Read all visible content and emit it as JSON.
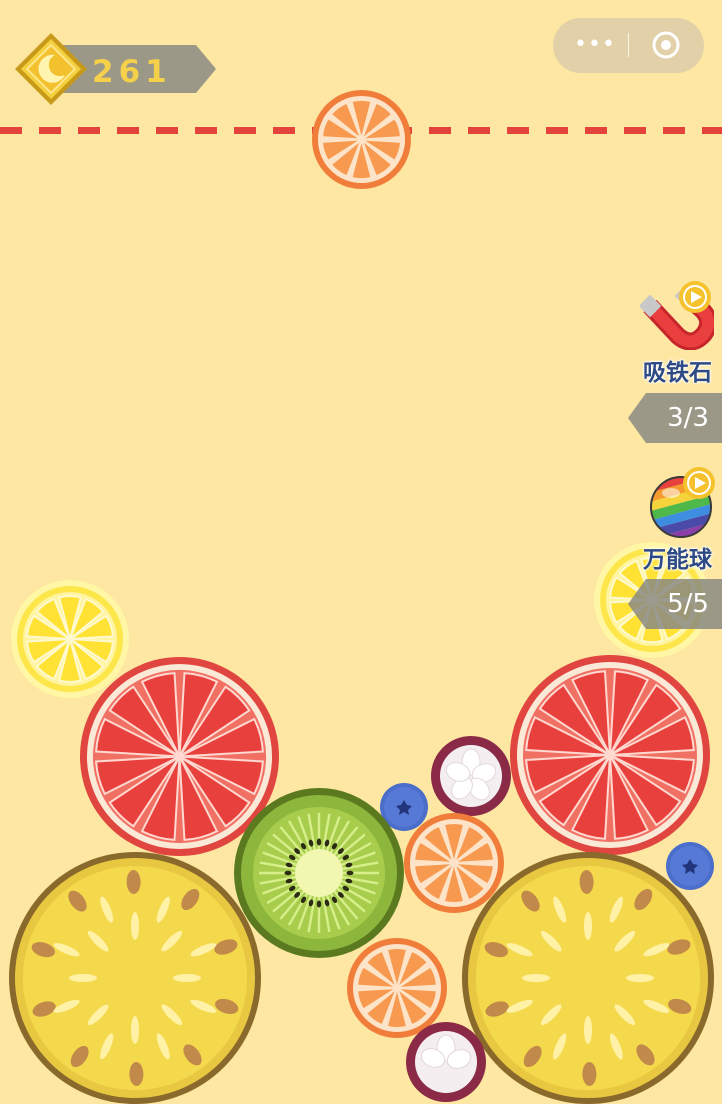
{
  "hud": {
    "score": "261",
    "score_icon": "moon-coin-icon",
    "menu_capsule": {
      "more_icon": "more-dots-icon",
      "close_icon": "target-circle-icon",
      "more_glyph": "•••"
    }
  },
  "powerups": [
    {
      "name": "吸铁石",
      "count": "3/3",
      "icon": "magnet-icon",
      "badge": "play-video-icon"
    },
    {
      "name": "万能球",
      "count": "5/5",
      "icon": "rainbow-ball-icon",
      "badge": "play-video-icon"
    }
  ],
  "playfield": {
    "limit_line_color": "#e3433b",
    "background_color": "#fde7a2",
    "next_fruit": "orange",
    "fruits": [
      {
        "kind": "orange",
        "role": "dropping"
      },
      {
        "kind": "lemon"
      },
      {
        "kind": "lemon"
      },
      {
        "kind": "grapefruit"
      },
      {
        "kind": "grapefruit"
      },
      {
        "kind": "kiwi"
      },
      {
        "kind": "mangosteen"
      },
      {
        "kind": "mangosteen"
      },
      {
        "kind": "blueberry"
      },
      {
        "kind": "blueberry"
      },
      {
        "kind": "orange"
      },
      {
        "kind": "orange"
      },
      {
        "kind": "pineapple"
      },
      {
        "kind": "pineapple"
      }
    ]
  }
}
